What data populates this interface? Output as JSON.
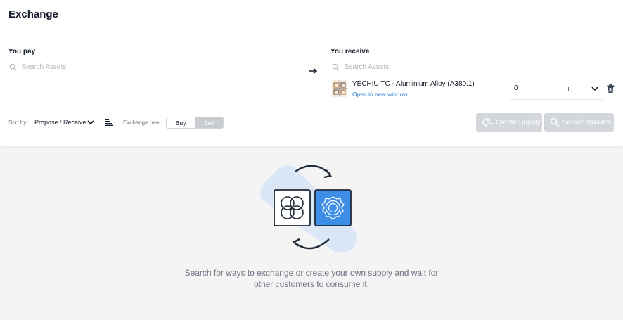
{
  "header": {
    "title": "Exchange"
  },
  "pay": {
    "label": "You pay",
    "search_placeholder": "Search Assets"
  },
  "receive": {
    "label": "You receive",
    "search_placeholder": "Search Assets",
    "asset": {
      "name": "YECHIU TC - Aluminium Alloy (A380.1)",
      "link": "Open in new window",
      "quantity": "0",
      "unit": "T"
    }
  },
  "controls": {
    "sort_label": "Sort by :",
    "sort_value": "Propose / Receive",
    "rate_label": "Exchange rate :",
    "rate_options": {
      "buy": "Buy",
      "sell": "Sell"
    },
    "rate_selected": "Sell"
  },
  "actions": {
    "create_supply": "Create Supply",
    "search_warps": "Search WARPs"
  },
  "empty_state": {
    "line1": "Search for ways to exchange or create your own supply and wait for",
    "line2": "other customers to consume it."
  },
  "colors": {
    "accent": "#3d8ee6",
    "link": "#2d7fd3",
    "disabled_button": "#d3d6da",
    "illustration_bg": "#dbe7f6"
  },
  "icons": [
    "search-icon",
    "arrow-right-icon",
    "chevron-down-icon",
    "trash-icon",
    "sort-icon",
    "tag-plus-icon",
    "search-icon",
    "refresh-arrows-icon"
  ]
}
